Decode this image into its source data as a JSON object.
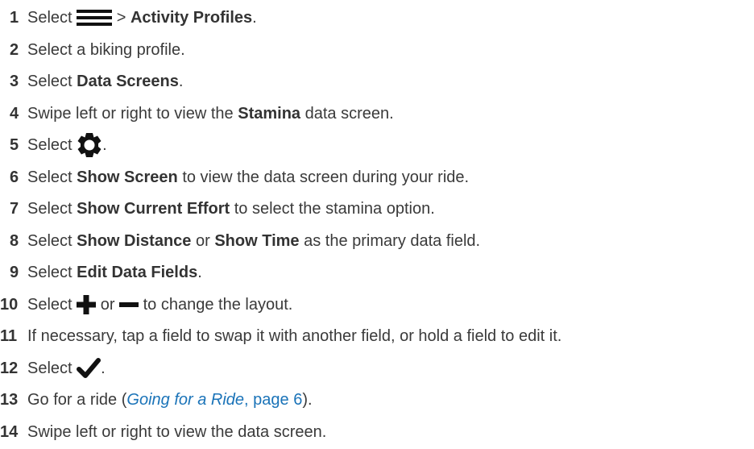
{
  "steps": [
    {
      "num": "1",
      "pre": "Select ",
      "mid": " > ",
      "bold": "Activity Profiles",
      "post": "."
    },
    {
      "num": "2",
      "text": "Select a biking profile."
    },
    {
      "num": "3",
      "pre": "Select ",
      "bold": "Data Screens",
      "post": "."
    },
    {
      "num": "4",
      "pre": "Swipe left or right to view the ",
      "bold": "Stamina",
      "post": " data screen."
    },
    {
      "num": "5",
      "pre": "Select ",
      "post": "."
    },
    {
      "num": "6",
      "pre": "Select ",
      "bold": "Show Screen",
      "post": " to view the data screen during your ride."
    },
    {
      "num": "7",
      "pre": "Select ",
      "bold": "Show Current Effort",
      "post": " to select the stamina option."
    },
    {
      "num": "8",
      "pre": "Select ",
      "bold": "Show Distance",
      "mid": " or ",
      "bold2": "Show Time",
      "post": " as the primary data field."
    },
    {
      "num": "9",
      "pre": "Select ",
      "bold": "Edit Data Fields",
      "post": "."
    },
    {
      "num": "10",
      "pre": "Select ",
      "mid": " or ",
      "post": " to change the layout."
    },
    {
      "num": "11",
      "text": "If necessary, tap a field to swap it with another field, or hold a field to edit it."
    },
    {
      "num": "12",
      "pre": "Select ",
      "post": "."
    },
    {
      "num": "13",
      "pre": "Go for a ride (",
      "link": "Going for a Ride",
      "link_page": ", page 6",
      "post": ")."
    },
    {
      "num": "14",
      "text": "Swipe left or right to view the data screen."
    }
  ],
  "icons": {
    "menu": "menu-icon",
    "gear": "gear-icon",
    "plus": "plus-icon",
    "minus": "minus-icon",
    "check": "checkmark-icon"
  },
  "colors": {
    "text": "#3a3a3a",
    "link": "#1a73b8",
    "icon": "#111111"
  }
}
